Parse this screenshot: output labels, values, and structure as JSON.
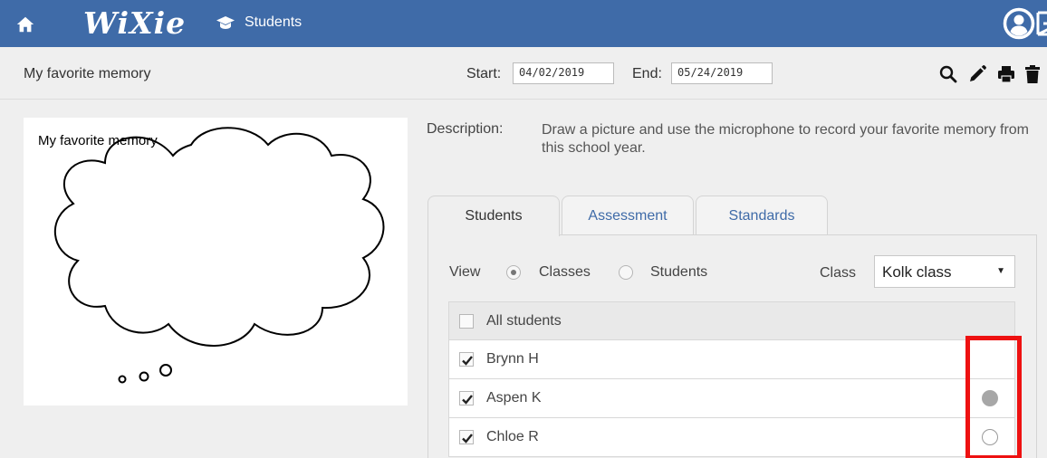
{
  "header": {
    "logo_text": "WiXie",
    "nav_students": "Students",
    "colors": {
      "bar": "#3f6ba8",
      "accent": "#3f6ba8",
      "highlight": "#e11111"
    },
    "icons": [
      "home-icon",
      "graduation-cap-icon",
      "account-icon",
      "logout-icon"
    ]
  },
  "toolbar": {
    "title": "My favorite memory",
    "start_label": "Start:",
    "start_value": "04/02/2019",
    "end_label": "End:",
    "end_value": "05/24/2019",
    "icons": [
      "search-icon",
      "pencil-icon",
      "print-icon",
      "trash-icon"
    ]
  },
  "canvas": {
    "caption": "My favorite memory"
  },
  "description": {
    "label": "Description:",
    "text": "Draw a picture and use the microphone to record your favorite memory from this school year."
  },
  "tabs": [
    {
      "label": "Students",
      "active": true
    },
    {
      "label": "Assessment",
      "active": false
    },
    {
      "label": "Standards",
      "active": false
    }
  ],
  "filters": {
    "view_label": "View",
    "option_classes": "Classes",
    "option_students": "Students",
    "selected": "Classes",
    "class_label": "Class",
    "class_value": "Kolk class"
  },
  "list": {
    "all_label": "All students",
    "all_checked": false,
    "students": [
      {
        "name": "Brynn H",
        "checked": true,
        "status": "none"
      },
      {
        "name": "Aspen K",
        "checked": true,
        "status": "filled"
      },
      {
        "name": "Chloe R",
        "checked": true,
        "status": "empty"
      }
    ]
  }
}
